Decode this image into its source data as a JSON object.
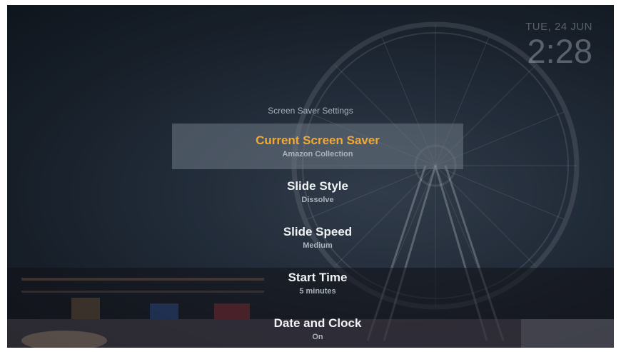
{
  "clock": {
    "date": "TUE, 24 JUN",
    "time": "2:28"
  },
  "menu": {
    "title": "Screen Saver Settings",
    "items": [
      {
        "label": "Current Screen Saver",
        "value": "Amazon Collection",
        "selected": true
      },
      {
        "label": "Slide Style",
        "value": "Dissolve"
      },
      {
        "label": "Slide Speed",
        "value": "Medium"
      },
      {
        "label": "Start Time",
        "value": "5 minutes"
      },
      {
        "label": "Date and Clock",
        "value": "On"
      }
    ]
  },
  "colors": {
    "accent": "#f3a92f",
    "text": "#f0f2f4",
    "muted": "#aab2bc"
  }
}
